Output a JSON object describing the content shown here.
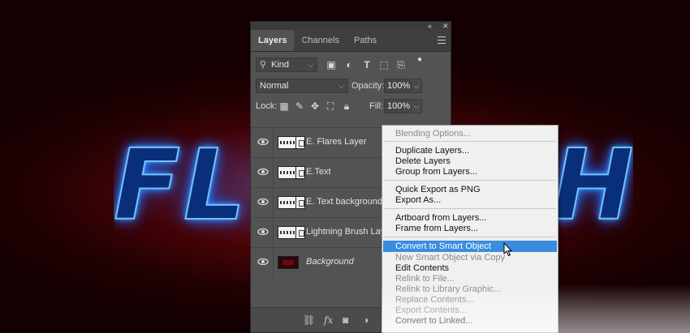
{
  "panel": {
    "tabs": [
      {
        "label": "Layers"
      },
      {
        "label": "Channels"
      },
      {
        "label": "Paths"
      }
    ],
    "filter": {
      "kind_label": "Kind"
    },
    "blend": {
      "mode": "Normal",
      "opacity_label": "Opacity:",
      "opacity_value": "100%"
    },
    "lock": {
      "label": "Lock:",
      "fill_label": "Fill:",
      "fill_value": "100%"
    },
    "layers": [
      {
        "name": "E. Flares Layer"
      },
      {
        "name": "E.Text"
      },
      {
        "name": "E. Text background"
      },
      {
        "name": "Lightning Brush Layer"
      },
      {
        "name": "Background"
      }
    ]
  },
  "context_menu": {
    "items": [
      {
        "label": "Blending Options...",
        "enabled": false
      },
      {
        "label": "Duplicate Layers...",
        "enabled": true
      },
      {
        "label": "Delete Layers",
        "enabled": true
      },
      {
        "label": "Group from Layers...",
        "enabled": true
      },
      {
        "label": "Quick Export as PNG",
        "enabled": true
      },
      {
        "label": "Export As...",
        "enabled": true
      },
      {
        "label": "Artboard from Layers...",
        "enabled": true
      },
      {
        "label": "Frame from Layers...",
        "enabled": true
      },
      {
        "label": "Convert to Smart Object",
        "enabled": true,
        "highlighted": true
      },
      {
        "label": "New Smart Object via Copy",
        "enabled": false
      },
      {
        "label": "Edit Contents",
        "enabled": true
      },
      {
        "label": "Relink to File...",
        "enabled": false
      },
      {
        "label": "Relink to Library Graphic...",
        "enabled": false
      },
      {
        "label": "Replace Contents...",
        "enabled": false
      },
      {
        "label": "Export Contents...",
        "enabled": false
      },
      {
        "label": "Convert to Linked...",
        "enabled": true
      }
    ]
  },
  "canvas_text": {
    "left": "FL",
    "right": "H"
  },
  "colors": {
    "highlight": "#3a8dde",
    "panel_bg": "#535353",
    "glow": "#4aa6ff"
  }
}
